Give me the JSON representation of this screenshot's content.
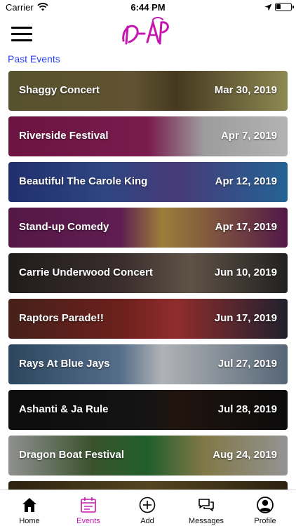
{
  "status_bar": {
    "carrier": "Carrier",
    "time": "6:44 PM"
  },
  "logo": {
    "text": "D-AP",
    "color": "#c516b0"
  },
  "section": {
    "title": "Past Events"
  },
  "events": [
    {
      "name": "Shaggy Concert",
      "date": "Mar 30, 2019"
    },
    {
      "name": "Riverside Festival",
      "date": "Apr 7, 2019"
    },
    {
      "name": "Beautiful The Carole King",
      "date": "Apr 12, 2019"
    },
    {
      "name": "Stand-up Comedy",
      "date": "Apr 17, 2019"
    },
    {
      "name": "Carrie Underwood Concert",
      "date": "Jun 10, 2019"
    },
    {
      "name": "Raptors Parade!!",
      "date": "Jun 17, 2019"
    },
    {
      "name": "Rays At Blue Jays",
      "date": "Jul 27, 2019"
    },
    {
      "name": "Ashanti & Ja Rule",
      "date": "Jul 28, 2019"
    },
    {
      "name": "Dragon Boat Festival",
      "date": "Aug 24, 2019"
    },
    {
      "name": "",
      "date": ""
    }
  ],
  "tab_bar": {
    "active": "events",
    "tabs": [
      {
        "id": "home",
        "label": "Home",
        "icon": "home-icon"
      },
      {
        "id": "events",
        "label": "Events",
        "icon": "calendar-icon"
      },
      {
        "id": "add",
        "label": "Add",
        "icon": "plus-circle-icon"
      },
      {
        "id": "messages",
        "label": "Messages",
        "icon": "chat-icon"
      },
      {
        "id": "profile",
        "label": "Profile",
        "icon": "profile-icon"
      }
    ]
  },
  "colors": {
    "accent": "#c516b0",
    "link": "#2a3ff0"
  }
}
